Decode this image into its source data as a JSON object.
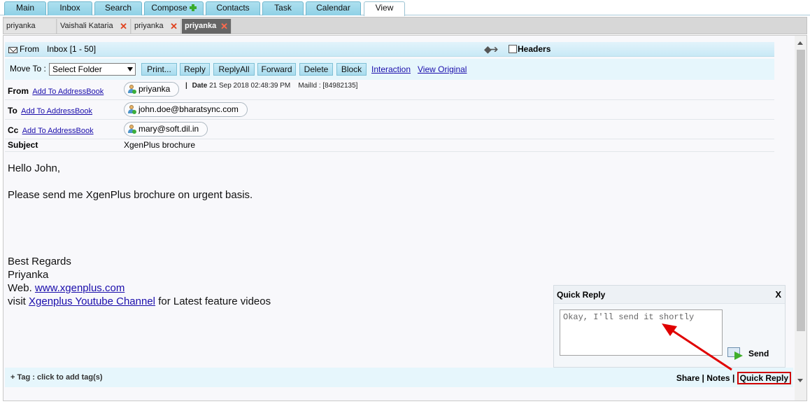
{
  "nav_tabs": [
    {
      "label": "Main"
    },
    {
      "label": "Inbox"
    },
    {
      "label": "Search"
    },
    {
      "label": "Compose"
    },
    {
      "label": "Contacts"
    },
    {
      "label": "Task"
    },
    {
      "label": "Calendar"
    },
    {
      "label": "View",
      "active": true
    }
  ],
  "mail_tabs": [
    {
      "label": "priyanka",
      "closable": false
    },
    {
      "label": "Vaishali Kataria",
      "closable": true
    },
    {
      "label": "priyanka",
      "closable": true
    },
    {
      "label": "priyanka",
      "closable": true,
      "active": true
    }
  ],
  "from_bar": {
    "from_label": "From",
    "folder_label": "Inbox [1 - 50]",
    "headers_label": "Headers",
    "headers_checked": false
  },
  "toolbar": {
    "move_to_label": "Move To :",
    "folder_select": "Select Folder",
    "buttons": [
      "Print...",
      "Reply",
      "ReplyAll",
      "Forward",
      "Delete",
      "Block"
    ],
    "interaction_link": "Interaction",
    "view_original_link": "View Original"
  },
  "headers": {
    "from_label": "From",
    "to_label": "To",
    "cc_label": "Cc",
    "subject_label": "Subject",
    "add_link": "Add To AddressBook",
    "from": "priyanka",
    "to": "john.doe@bharatsync.com",
    "cc": "mary@soft.dil.in",
    "subject": "XgenPlus brochure",
    "date_label": "Date",
    "date": "21 Sep 2018 02:48:39 PM",
    "mailid_label": "MailId :",
    "mailid": "[84982135]"
  },
  "body": {
    "greeting": "Hello John,",
    "line1": "Please send me XgenPlus brochure on urgent basis.",
    "signoff": "Best Regards",
    "name": "Priyanka",
    "web_prefix": "Web.",
    "web_link": "www.xgenplus.com",
    "visit_prefix": "visit",
    "youtube_link": "Xgenplus Youtube Channel",
    "visit_suffix": "for Latest feature videos"
  },
  "quick_reply": {
    "title": "Quick Reply",
    "close": "X",
    "text": "Okay, I'll send it shortly",
    "send_label": "Send"
  },
  "footer": {
    "tag_label": "+ Tag : click to add tag(s)",
    "share": "Share",
    "notes": "Notes",
    "separator": "|",
    "quick_reply": "Quick Reply"
  },
  "colors": {
    "tab_blue": "#8fd1e6",
    "toolbar_bg": "#e6f6fc",
    "annotation_red": "#e00000"
  }
}
